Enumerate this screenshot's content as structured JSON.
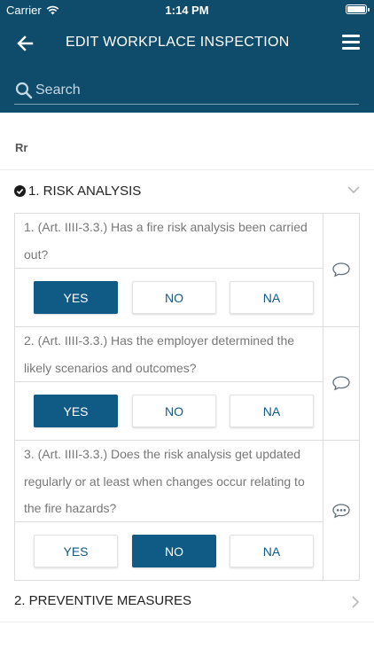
{
  "status_bar": {
    "carrier": "Carrier",
    "time": "1:14 PM",
    "battery_level": 1.0
  },
  "nav": {
    "title": "EDIT WORKPLACE INSPECTION",
    "back_icon": "arrow-left-icon",
    "menu_icon": "hamburger-menu-icon"
  },
  "search": {
    "placeholder": "Search",
    "value": ""
  },
  "user": {
    "name": "Rr"
  },
  "sections": [
    {
      "title": "1. RISK ANALYSIS",
      "completed": true,
      "expanded": true
    },
    {
      "title": "2. PREVENTIVE MEASURES",
      "completed": false,
      "expanded": false
    }
  ],
  "options": [
    "YES",
    "NO",
    "NA"
  ],
  "questions": [
    {
      "text": "1. (Art. IIII-3.3.) Has a fire risk analysis been carried out?",
      "answer": "YES",
      "has_comment": false
    },
    {
      "text": "2. (Art. IIII-3.3.) Has the employer determined the likely scenarios and outcomes?",
      "answer": "YES",
      "has_comment": false
    },
    {
      "text": "3. (Art. IIII-3.3.) Does the risk analysis get updated regularly or at least when changes occur relating to the fire hazards?",
      "answer": "NO",
      "has_comment": true
    }
  ],
  "colors": {
    "header": "#0f4c6b",
    "accent": "#0f5b85"
  }
}
